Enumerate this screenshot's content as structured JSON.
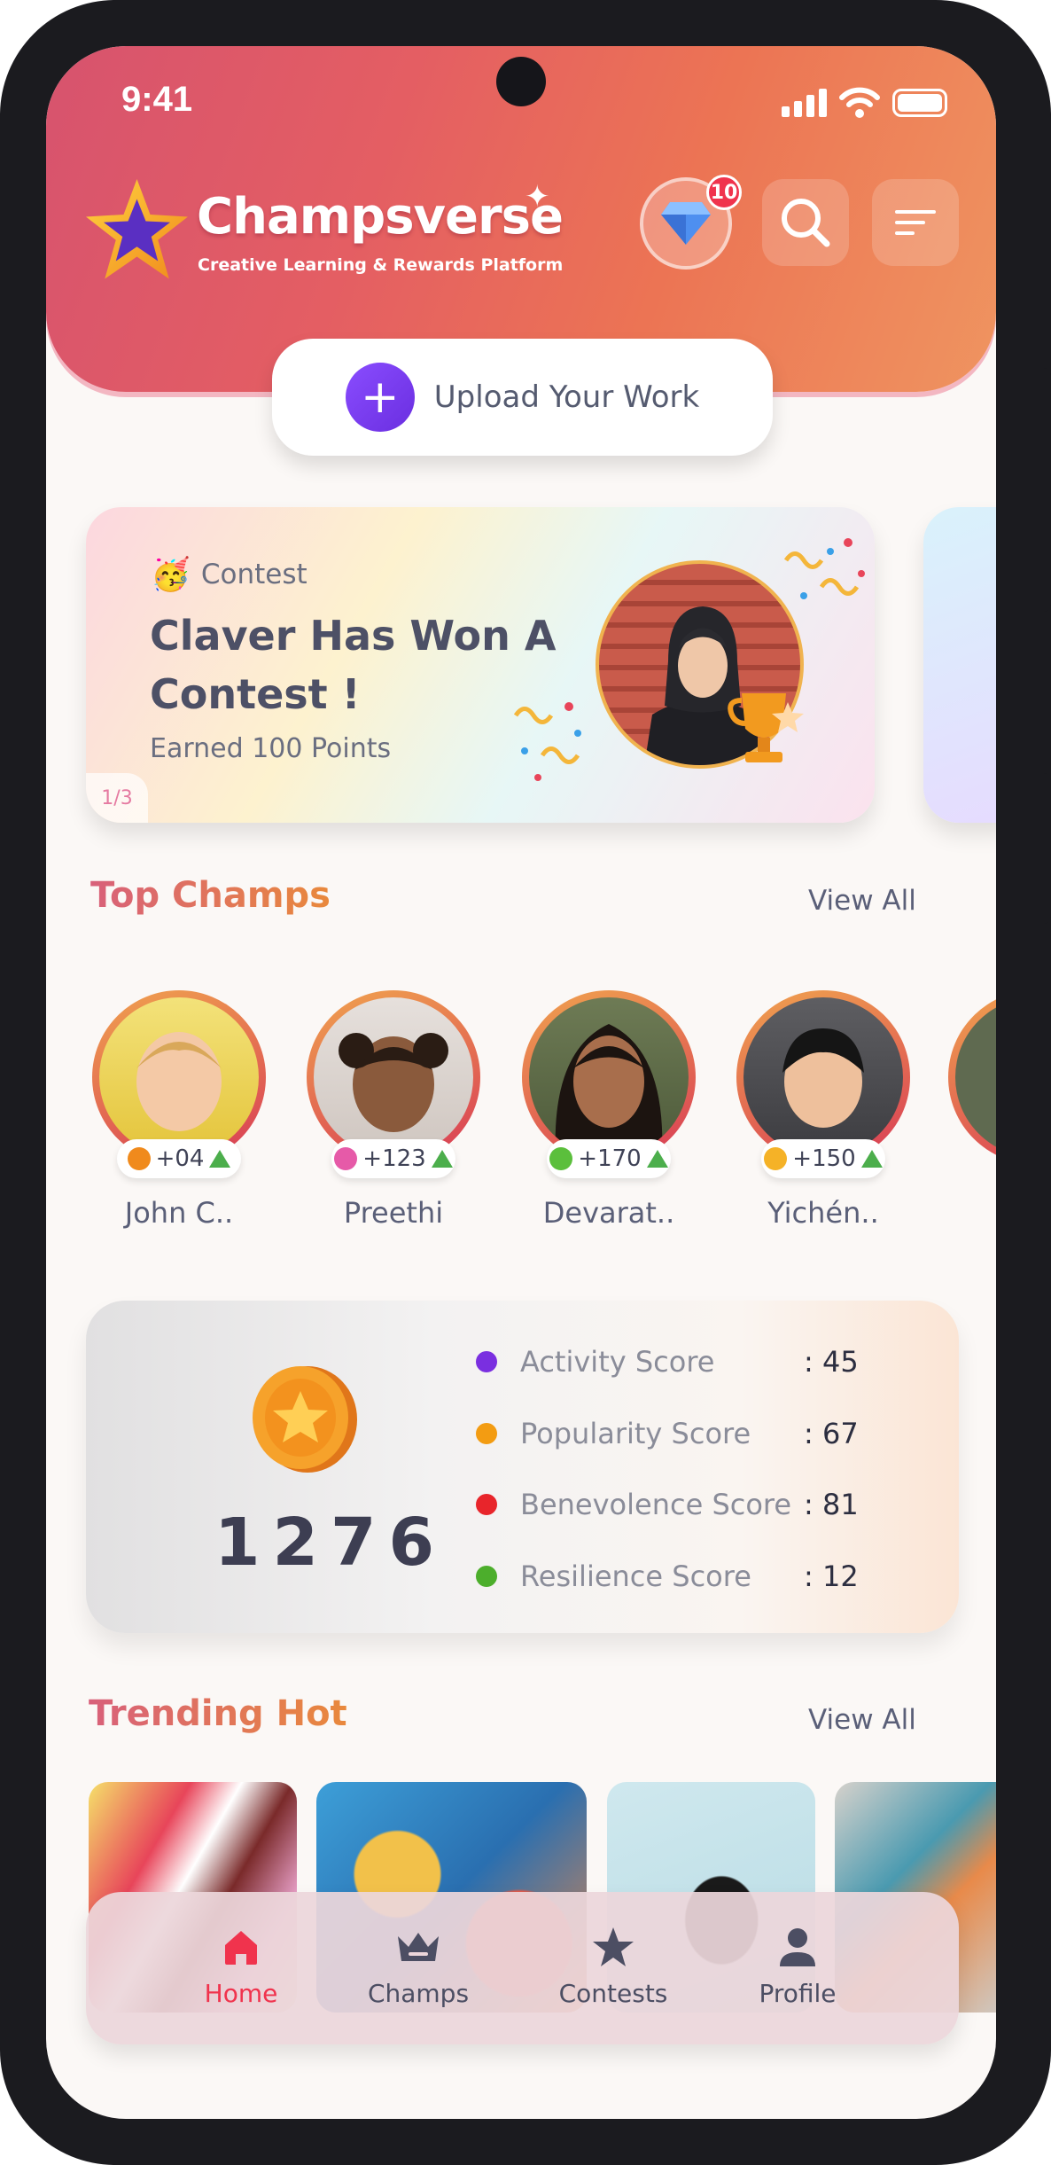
{
  "status_bar": {
    "time": "9:41"
  },
  "header": {
    "brand": "Champsverse",
    "tagline": "Creative Learning & Rewards Platform",
    "notification_count": "10",
    "icons": {
      "gem": "diamond-icon",
      "search": "search-icon",
      "menu": "menu-icon"
    }
  },
  "upload": {
    "label": "Upload Your Work",
    "icon": "plus-icon"
  },
  "contest_card": {
    "tag_emoji": "🥳",
    "tag": "Contest",
    "title": "Claver Has Won A Contest !",
    "subtitle": "Earned 100 Points",
    "page_indicator": "1/3"
  },
  "top_champs": {
    "title": "Top Champs",
    "view_all": "View All",
    "items": [
      {
        "name": "John C..",
        "points": "+04",
        "badge_color": "#f08a1c"
      },
      {
        "name": "Preethi",
        "points": "+123",
        "badge_color": "#e65aa8"
      },
      {
        "name": "Devarat..",
        "points": "+170",
        "badge_color": "#5bbf3c"
      },
      {
        "name": "Yichén..",
        "points": "+150",
        "badge_color": "#f5b227"
      }
    ]
  },
  "scores": {
    "total": "1276",
    "items": [
      {
        "label": "Activity Score",
        "value": ": 45",
        "color": "#7a2fe0"
      },
      {
        "label": "Popularity Score",
        "value": ": 67",
        "color": "#f39c12"
      },
      {
        "label": "Benevolence Score",
        "value": ": 81",
        "color": "#e8252b"
      },
      {
        "label": "Resilience Score",
        "value": ": 12",
        "color": "#4cae2c"
      }
    ]
  },
  "trending": {
    "title": "Trending Hot",
    "view_all": "View All"
  },
  "bottom_nav": {
    "items": [
      {
        "label": "Home",
        "icon": "home-icon",
        "active": true
      },
      {
        "label": "Champs",
        "icon": "crown-icon",
        "active": false
      },
      {
        "label": "Contests",
        "icon": "star-icon",
        "active": false
      },
      {
        "label": "Profile",
        "icon": "person-icon",
        "active": false
      }
    ]
  },
  "colors": {
    "accent": "#f0334d",
    "brand_gradient_start": "#d7536e",
    "brand_gradient_end": "#ef9460"
  }
}
